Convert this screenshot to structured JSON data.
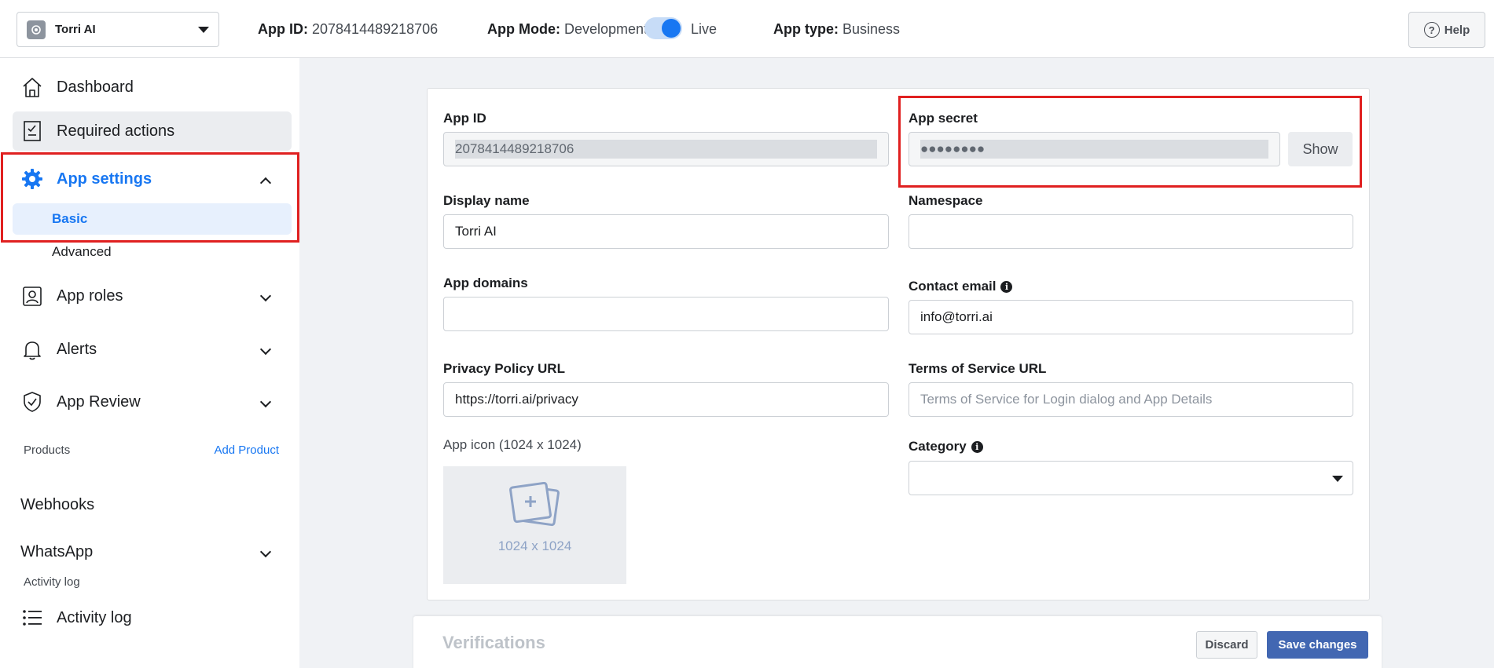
{
  "topbar": {
    "app_name": "Torri AI",
    "app_id_label": "App ID:",
    "app_id_value": "2078414489218706",
    "app_mode_label": "App Mode:",
    "app_mode_dev": "Development",
    "app_mode_live": "Live",
    "app_mode_is_live": true,
    "app_type_label": "App type:",
    "app_type_value": "Business",
    "help_label": "Help"
  },
  "sidebar": {
    "dashboard": "Dashboard",
    "required_actions": "Required actions",
    "app_settings": "App settings",
    "basic": "Basic",
    "advanced": "Advanced",
    "app_roles": "App roles",
    "alerts": "Alerts",
    "app_review": "App Review",
    "products_label": "Products",
    "add_product": "Add Product",
    "webhooks": "Webhooks",
    "whatsapp": "WhatsApp",
    "activity_log_section": "Activity log",
    "activity_log": "Activity log"
  },
  "form": {
    "app_id_label": "App ID",
    "app_id_value": "2078414489218706",
    "app_secret_label": "App secret",
    "app_secret_value": "●●●●●●●●",
    "show_label": "Show",
    "display_name_label": "Display name",
    "display_name_value": "Torri AI",
    "namespace_label": "Namespace",
    "namespace_value": "",
    "app_domains_label": "App domains",
    "app_domains_value": "",
    "contact_email_label": "Contact email",
    "contact_email_value": "info@torri.ai",
    "privacy_label": "Privacy Policy URL",
    "privacy_value": "https://torri.ai/privacy",
    "tos_label": "Terms of Service URL",
    "tos_placeholder": "Terms of Service for Login dialog and App Details",
    "app_icon_label": "App icon (1024 x 1024)",
    "app_icon_dim": "1024 x 1024",
    "category_label": "Category",
    "category_value": ""
  },
  "footer": {
    "verifications": "Verifications",
    "discard": "Discard",
    "save": "Save changes"
  },
  "colors": {
    "accent": "#1877f2",
    "primary_button": "#4267b2",
    "highlight": "#e02020"
  }
}
